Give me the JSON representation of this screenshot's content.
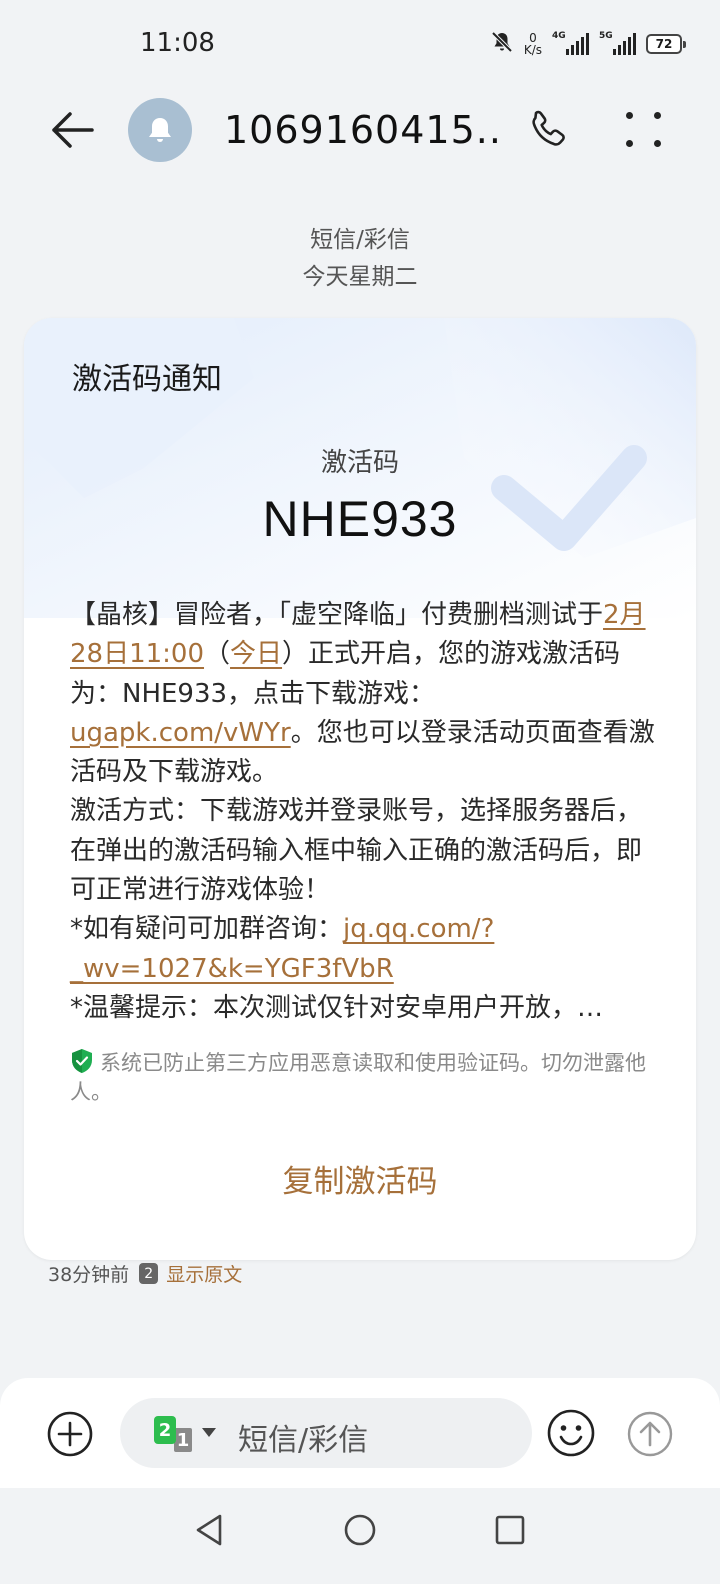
{
  "status_bar": {
    "time": "11:08",
    "net_speed_value": "0",
    "net_speed_unit": "K/s",
    "sim1_tag": "4G",
    "sim2_tag": "5G",
    "battery": "72",
    "icons": [
      "mute-bell-icon",
      "signal-icon",
      "signal-icon",
      "battery-icon"
    ]
  },
  "header": {
    "contact_name": "1069160415...",
    "avatar_icon": "bell-icon",
    "back_icon": "arrow-left-icon",
    "call_icon": "phone-icon",
    "more_icon": "more-dots-icon"
  },
  "conversation": {
    "message_type": "短信/彩信",
    "day": "今天星期二"
  },
  "card": {
    "title": "激活码通知",
    "code_label": "激活码",
    "code_value": "NHE933",
    "body": {
      "p1": "【晶核】冒险者，「虚空降临」付费删档测试于",
      "link_date": "2月28日11:00",
      "p2": "（",
      "link_today": "今日",
      "p3": "）正式开启，您的游戏激活码为：NHE933，点击下载游戏：",
      "link_download": "ugapk.com/vWYr",
      "p4": "。您也可以登录活动页面查看激活码及下载游戏。",
      "p5": "激活方式：下载游戏并登录账号，选择服务器后，在弹出的激活码输入框中输入正确的激活码后，即可正常进行游戏体验！",
      "p6": "*如有疑问可加群咨询：",
      "link_group": "jq.qq.com/?_wv=1027&k=YGF3fVbR",
      "p7": "*温馨提示：本次测试仅针对安卓用户开放，…"
    },
    "safety_notice": "系统已防止第三方应用恶意读取和使用验证码。切勿泄露他人。",
    "copy_button": "复制激活码"
  },
  "meta": {
    "time_ago": "38分钟前",
    "sim_badge": "2",
    "show_original": "显示原文"
  },
  "input_bar": {
    "sim_selected": "2",
    "sim_other": "1",
    "placeholder": "短信/彩信"
  },
  "colors": {
    "accent": "#a6703a",
    "background": "#f1f3f5",
    "card": "#ffffff",
    "sim2_green": "#2dbd4e",
    "avatar": "#a9bfd2"
  }
}
